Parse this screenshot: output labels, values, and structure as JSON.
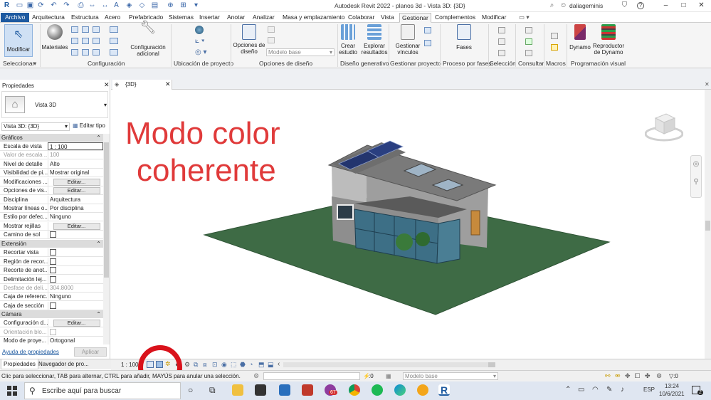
{
  "titlebar": {
    "title": "Autodesk Revit 2022 - planos 3d - Vista 3D: {3D}",
    "user": "daliageminis",
    "help": "?"
  },
  "tabs": [
    "Archivo",
    "Arquitectura",
    "Estructura",
    "Acero",
    "Prefabricado",
    "Sistemas",
    "Insertar",
    "Anotar",
    "Analizar",
    "Masa y emplazamiento",
    "Colaborar",
    "Vista",
    "Gestionar",
    "Complementos",
    "Modificar"
  ],
  "ribbon": {
    "modificar": "Modificar",
    "seleccionar": "Seleccionar",
    "materiales": "Materiales",
    "config_adicional": [
      "Configuración",
      "adicional"
    ],
    "configuracion": "Configuración",
    "ubicacion": "Ubicación de proyecto",
    "opciones_diseno_btn": [
      "Opciones de",
      "diseño"
    ],
    "modelo_base": "Modelo base",
    "opciones_diseno": "Opciones de diseño",
    "crear_estudio": [
      "Crear",
      "estudio"
    ],
    "explorar": [
      "Explorar",
      "resultados"
    ],
    "diseno_generativo": "Diseño generativo",
    "gestionar_vinculos": [
      "Gestionar",
      "vínculos"
    ],
    "gestionar_proyecto": "Gestionar proyecto",
    "fases_btn": "Fases",
    "proceso_fases": "Proceso por fases",
    "seleccion": "Selección",
    "consultar": "Consultar",
    "macros": "Macros",
    "dynamo": "Dynamo",
    "reproductor": [
      "Reproductor",
      "de Dynamo"
    ],
    "programacion_visual": "Programación visual"
  },
  "properties": {
    "title": "Propiedades",
    "type_name": "Vista 3D",
    "selector": "Vista 3D: {3D}",
    "edit_type": "Editar tipo",
    "section_graficos": "Gráficos",
    "rows_graficos": [
      {
        "k": "Escala de vista",
        "v": "1 : 100"
      },
      {
        "k": "Valor de escala ...",
        "v": "100"
      },
      {
        "k": "Nivel de detalle",
        "v": "Alto"
      },
      {
        "k": "Visibilidad de pi...",
        "v": "Mostrar original"
      },
      {
        "k": "Modificaciones ...",
        "v": "Editar..."
      },
      {
        "k": "Opciones de vis...",
        "v": "Editar..."
      },
      {
        "k": "Disciplina",
        "v": "Arquitectura"
      },
      {
        "k": "Mostrar líneas o...",
        "v": "Por disciplina"
      },
      {
        "k": "Estilo por defec...",
        "v": "Ninguno"
      },
      {
        "k": "Mostrar rejillas",
        "v": "Editar..."
      },
      {
        "k": "Camino de sol",
        "v": ""
      }
    ],
    "section_extension": "Extensión",
    "rows_extension": [
      {
        "k": "Recortar vista",
        "v": ""
      },
      {
        "k": "Región de recor...",
        "v": ""
      },
      {
        "k": "Recorte de anot...",
        "v": ""
      },
      {
        "k": "Delimitación lej...",
        "v": ""
      },
      {
        "k": "Desfase de deli...",
        "v": "304.8000"
      },
      {
        "k": "Caja de referenc...",
        "v": "Ninguno"
      },
      {
        "k": "Caja de sección",
        "v": ""
      }
    ],
    "section_camara": "Cámara",
    "rows_camara": [
      {
        "k": "Configuración d...",
        "v": "Editar..."
      },
      {
        "k": "Orientación blo...",
        "v": ""
      },
      {
        "k": "Modo de proye...",
        "v": "Ortogonal"
      }
    ],
    "help_link": "Ayuda de propiedades",
    "apply": "Aplicar",
    "bottom_tabs": [
      "Propiedades",
      "Navegador de pro..."
    ]
  },
  "view": {
    "tab_label": "{3D}",
    "overlay_line1": "Modo color",
    "overlay_line2": "coherente",
    "scale": "1 : 100",
    "overlay_color": "#e03a3a"
  },
  "status": {
    "message": "Clic para seleccionar, TAB para alternar, CTRL para añadir, MAYÚS para anular una selección.",
    "zero": ":0",
    "model": "Modelo base",
    "filter": "▽:0"
  },
  "taskbar": {
    "search_placeholder": "Escribe aquí para buscar",
    "lang": "ESP",
    "time": "13:24",
    "date": "10/6/2021",
    "badge_67": "67",
    "badge_2": "2"
  }
}
